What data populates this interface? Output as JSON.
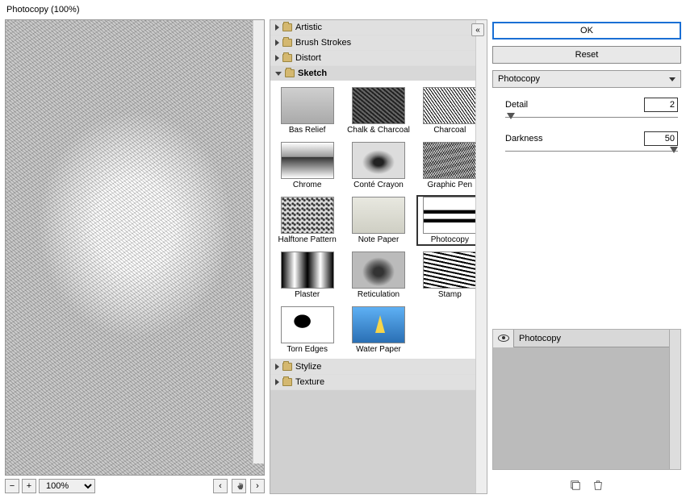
{
  "header": {
    "title": "Photocopy (100%)"
  },
  "preview": {
    "zoom_minus": "−",
    "zoom_plus": "+",
    "zoom_value": "100%",
    "nav_left": "‹",
    "nav_right": "›"
  },
  "gallery": {
    "collapse_icon": "«",
    "categories": [
      {
        "label": "Artistic",
        "open": false
      },
      {
        "label": "Brush Strokes",
        "open": false
      },
      {
        "label": "Distort",
        "open": false
      },
      {
        "label": "Sketch",
        "open": true
      },
      {
        "label": "Stylize",
        "open": false
      },
      {
        "label": "Texture",
        "open": false
      }
    ],
    "sketch_thumbs": [
      {
        "label": "Bas Relief",
        "cls": "th-basrelief"
      },
      {
        "label": "Chalk & Charcoal",
        "cls": "th-chalk"
      },
      {
        "label": "Charcoal",
        "cls": "th-charcoal"
      },
      {
        "label": "Chrome",
        "cls": "th-chrome"
      },
      {
        "label": "Conté Crayon",
        "cls": "th-conte"
      },
      {
        "label": "Graphic Pen",
        "cls": "th-graphic"
      },
      {
        "label": "Halftone Pattern",
        "cls": "th-halftone"
      },
      {
        "label": "Note Paper",
        "cls": "th-notepaper"
      },
      {
        "label": "Photocopy",
        "cls": "th-photocopy",
        "selected": true
      },
      {
        "label": "Plaster",
        "cls": "th-plaster"
      },
      {
        "label": "Reticulation",
        "cls": "th-reticulation"
      },
      {
        "label": "Stamp",
        "cls": "th-stamp"
      },
      {
        "label": "Torn Edges",
        "cls": "th-torn"
      },
      {
        "label": "Water Paper",
        "cls": "th-water"
      }
    ]
  },
  "controls": {
    "ok_label": "OK",
    "reset_label": "Reset",
    "filter_name": "Photocopy",
    "params": [
      {
        "label": "Detail",
        "value": "2",
        "pos": 2
      },
      {
        "label": "Darkness",
        "value": "50",
        "pos": 100
      }
    ]
  },
  "layers": {
    "items": [
      {
        "label": "Photocopy",
        "visible": true
      }
    ],
    "new_icon": "new-layer-icon",
    "trash_icon": "trash-icon"
  }
}
